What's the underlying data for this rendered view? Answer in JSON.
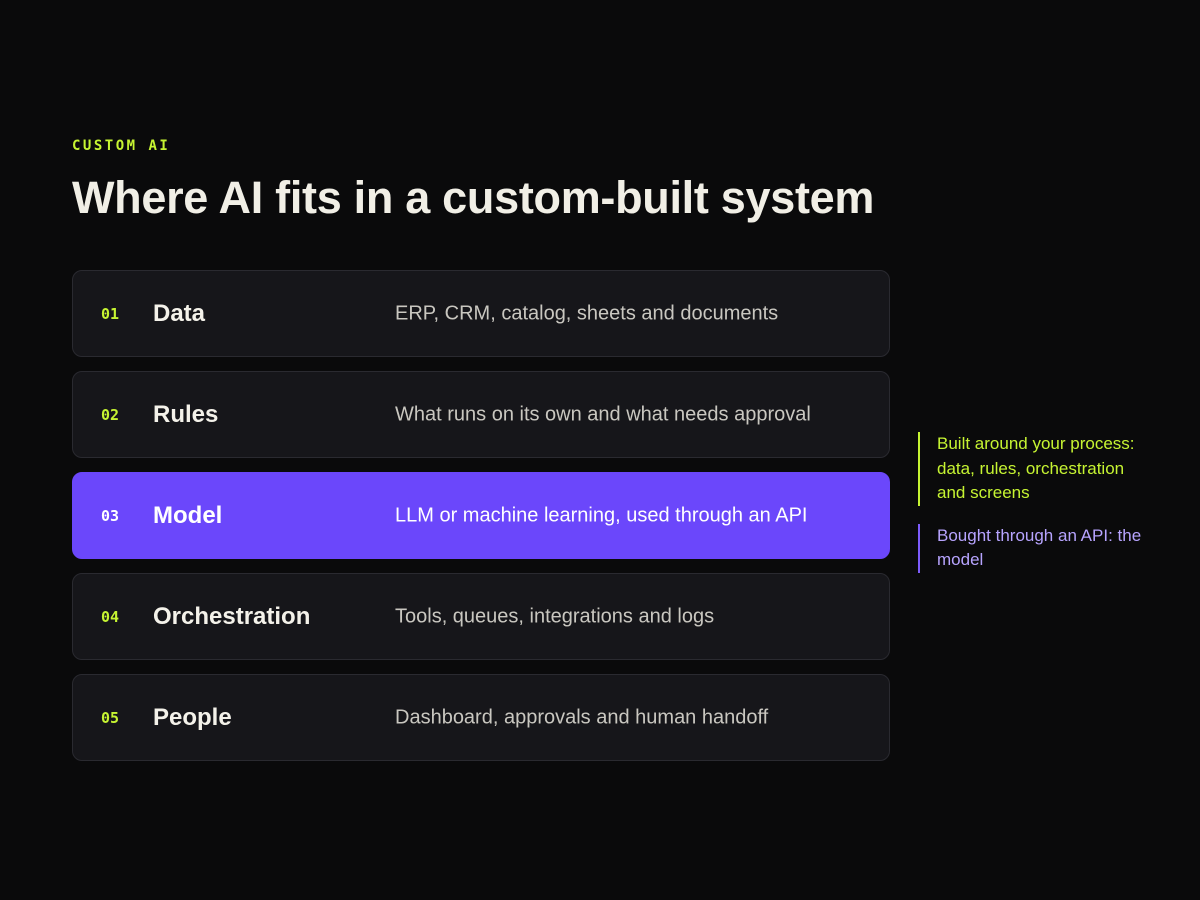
{
  "eyebrow": "CUSTOM AI",
  "title": "Where AI fits in a custom-built system",
  "layers": [
    {
      "num": "01",
      "name": "Data",
      "desc": "ERP, CRM, catalog, sheets and documents"
    },
    {
      "num": "02",
      "name": "Rules",
      "desc": "What runs on its own and what needs approval"
    },
    {
      "num": "03",
      "name": "Model",
      "desc": "LLM or machine learning, used through an API"
    },
    {
      "num": "04",
      "name": "Orchestration",
      "desc": "Tools, queues, integrations and logs"
    },
    {
      "num": "05",
      "name": "People",
      "desc": "Dashboard, approvals and human handoff"
    }
  ],
  "highlighted_layer": "03",
  "notes": {
    "custom": "Built around your process: data, rules, orchestration and screens",
    "bought": "Bought through an API: the model"
  },
  "colors": {
    "background": "#0a0a0b",
    "accent_lime": "#c6f432",
    "accent_purple": "#6b47fb",
    "note_purple": "#b7a4ff"
  }
}
